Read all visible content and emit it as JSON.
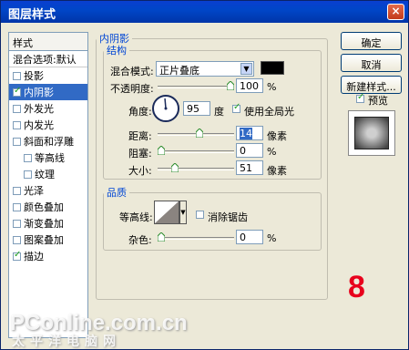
{
  "window": {
    "title": "图层样式",
    "close": "×"
  },
  "left_panel": {
    "header": "样式",
    "blend_item": "混合选项:默认",
    "items": [
      {
        "label": "投影",
        "checked": false,
        "sub": false,
        "selected": false
      },
      {
        "label": "内阴影",
        "checked": true,
        "sub": false,
        "selected": true
      },
      {
        "label": "外发光",
        "checked": false,
        "sub": false,
        "selected": false
      },
      {
        "label": "内发光",
        "checked": false,
        "sub": false,
        "selected": false
      },
      {
        "label": "斜面和浮雕",
        "checked": false,
        "sub": false,
        "selected": false
      },
      {
        "label": "等高线",
        "checked": false,
        "sub": true,
        "selected": false
      },
      {
        "label": "纹理",
        "checked": false,
        "sub": true,
        "selected": false
      },
      {
        "label": "光泽",
        "checked": false,
        "sub": false,
        "selected": false
      },
      {
        "label": "颜色叠加",
        "checked": false,
        "sub": false,
        "selected": false
      },
      {
        "label": "渐变叠加",
        "checked": false,
        "sub": false,
        "selected": false
      },
      {
        "label": "图案叠加",
        "checked": false,
        "sub": false,
        "selected": false
      },
      {
        "label": "描边",
        "checked": true,
        "sub": false,
        "selected": false
      }
    ]
  },
  "inner_shadow": {
    "legend": "内阴影",
    "structure": {
      "legend": "结构",
      "blend_mode_label": "混合模式:",
      "blend_mode_value": "正片叠底",
      "blend_color": "#000000",
      "opacity_label": "不透明度:",
      "opacity_value": "100",
      "opacity_unit": "%",
      "opacity_level": 1.0,
      "angle_label": "角度:",
      "angle_value": "95",
      "angle_unit": "度",
      "global_light_label": "使用全局光",
      "global_light_checked": true,
      "distance_label": "距离:",
      "distance_value": "14",
      "distance_unit": "像素",
      "distance_level": 0.55,
      "choke_label": "阻塞:",
      "choke_value": "0",
      "choke_unit": "%",
      "choke_level": 0.0,
      "size_label": "大小:",
      "size_value": "51",
      "size_unit": "像素",
      "size_level": 0.2
    },
    "quality": {
      "legend": "品质",
      "contour_label": "等高线:",
      "antialias_label": "消除锯齿",
      "antialias_checked": false,
      "noise_label": "杂色:",
      "noise_value": "0",
      "noise_unit": "%",
      "noise_level": 0.0
    }
  },
  "buttons": {
    "ok": "确定",
    "cancel": "取消",
    "new_style": "新建样式...",
    "preview_label": "预览",
    "preview_checked": true
  },
  "annotation": {
    "number": "8"
  },
  "watermark": {
    "line1": "PConline.com.cn",
    "line2": "太平洋电脑网"
  }
}
